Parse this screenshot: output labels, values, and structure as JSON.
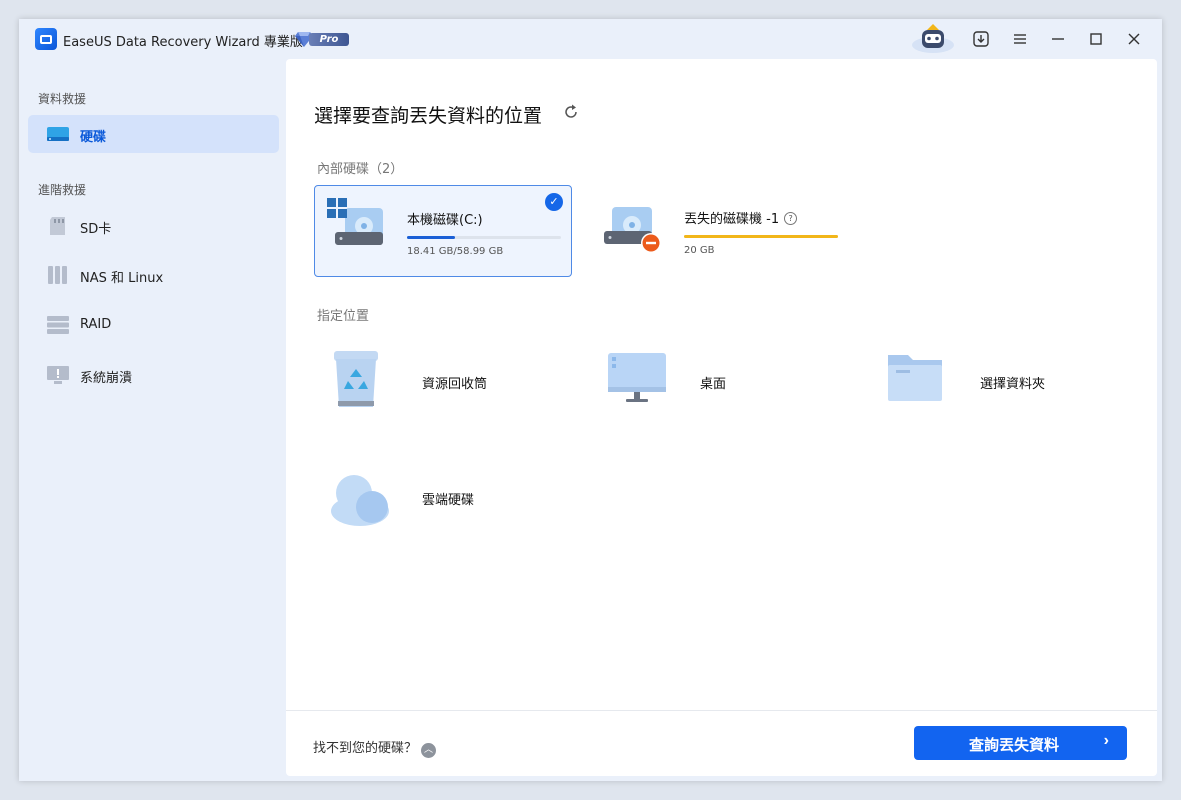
{
  "app": {
    "title": "EaseUS Data Recovery Wizard 專業版",
    "badge": "Pro",
    "accent": "#1264f0"
  },
  "titlebar": {
    "buttons": [
      "download-icon",
      "menu-icon",
      "minimize-icon",
      "maximize-icon",
      "close-icon"
    ]
  },
  "sidebar": {
    "section1": "資料救援",
    "section2": "進階救援",
    "items": [
      {
        "label": "硬碟",
        "icon": "hard-drive-icon",
        "active": true
      },
      {
        "label": "SD卡",
        "icon": "sd-card-icon"
      },
      {
        "label": "NAS 和 Linux",
        "icon": "nas-icon"
      },
      {
        "label": "RAID",
        "icon": "raid-icon"
      },
      {
        "label": "系統崩潰",
        "icon": "system-crash-icon"
      }
    ]
  },
  "main": {
    "title": "選擇要查詢丟失資料的位置",
    "internal_label": "內部硬碟（2）",
    "disks": [
      {
        "name": "本機磁碟(C:)",
        "size": "18.41 GB/58.99 GB",
        "usage": 0.31,
        "bar_color": "#1a5fd6",
        "selected": true
      },
      {
        "name": "丟失的磁碟機 -1",
        "size": "20 GB",
        "usage": 1.0,
        "bar_color": "#f2b619",
        "selected": false
      }
    ],
    "locations_label": "指定位置",
    "locations": [
      {
        "label": "資源回收筒",
        "icon": "recycle-bin-icon"
      },
      {
        "label": "桌面",
        "icon": "desktop-icon"
      },
      {
        "label": "選擇資料夾",
        "icon": "folder-icon"
      },
      {
        "label": "雲端硬碟",
        "icon": "cloud-icon"
      }
    ]
  },
  "footer": {
    "link": "找不到您的硬碟？",
    "button": "查詢丟失資料"
  }
}
